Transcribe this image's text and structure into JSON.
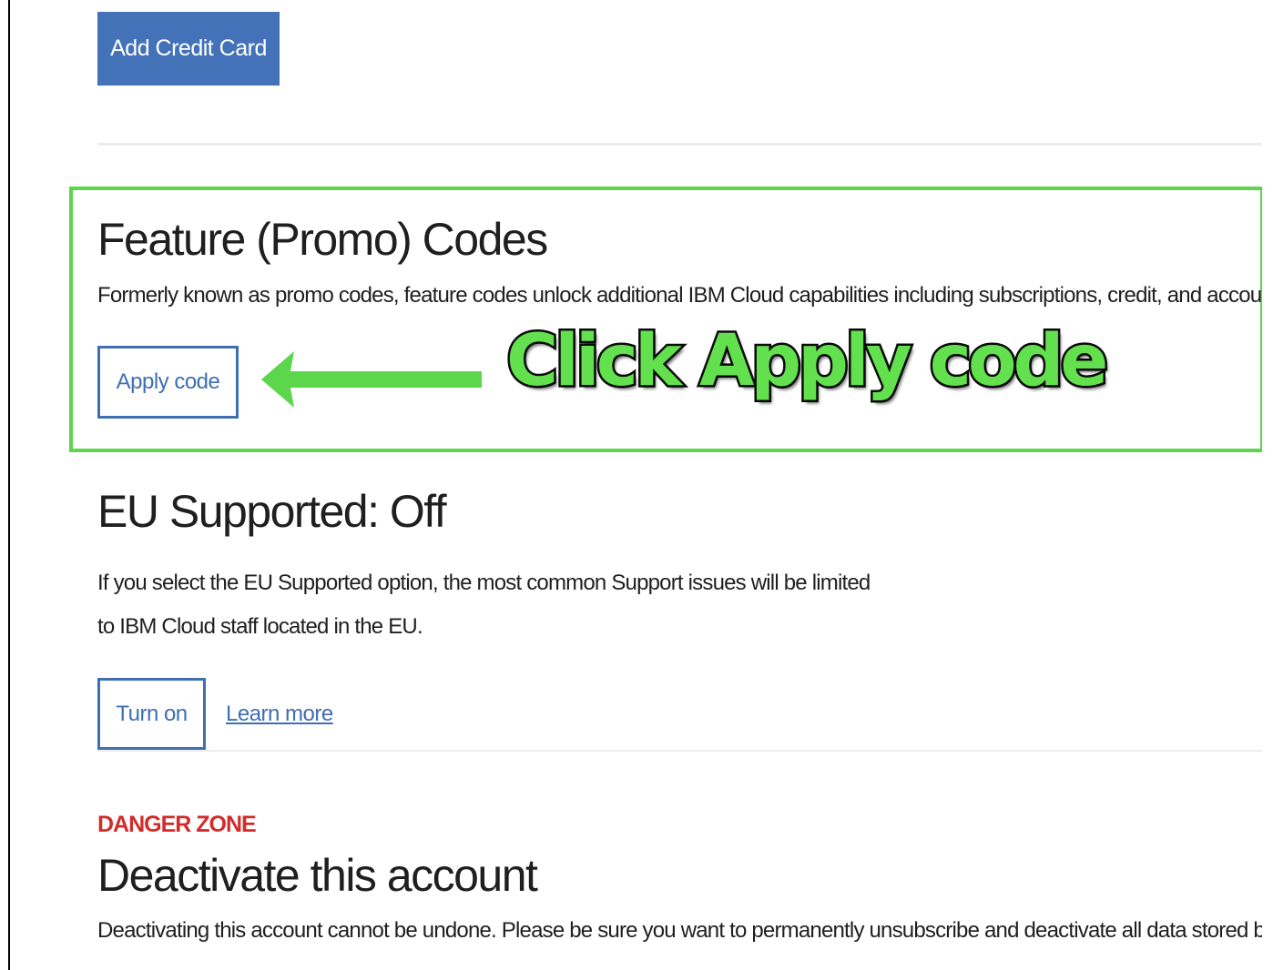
{
  "billing": {
    "add_card_label": "Add Credit Card"
  },
  "feature_codes": {
    "title": "Feature (Promo) Codes",
    "description": "Formerly known as promo codes, feature codes unlock additional IBM Cloud capabilities including subscriptions, credit, and account exte",
    "apply_label": "Apply code"
  },
  "annotation": {
    "callout_text": "Click Apply code",
    "highlight_color": "#5cd64a",
    "arrow_color": "#5cd64a"
  },
  "eu_support": {
    "title": "EU Supported: Off",
    "description_line1": "If you select the EU Supported option, the most common Support issues will be limited",
    "description_line2": "to IBM Cloud staff located in the EU.",
    "turn_on_label": "Turn on",
    "learn_more_label": "Learn more"
  },
  "danger_zone": {
    "label": "DANGER ZONE",
    "title": "Deactivate this account",
    "description": "Deactivating this account cannot be undone. Please be sure you want to permanently unsubscribe and deactivate all data stored by IBM C"
  },
  "colors": {
    "primary_button": "#4472b8",
    "link_blue": "#3f6eb3",
    "danger_red": "#d42a2a"
  }
}
